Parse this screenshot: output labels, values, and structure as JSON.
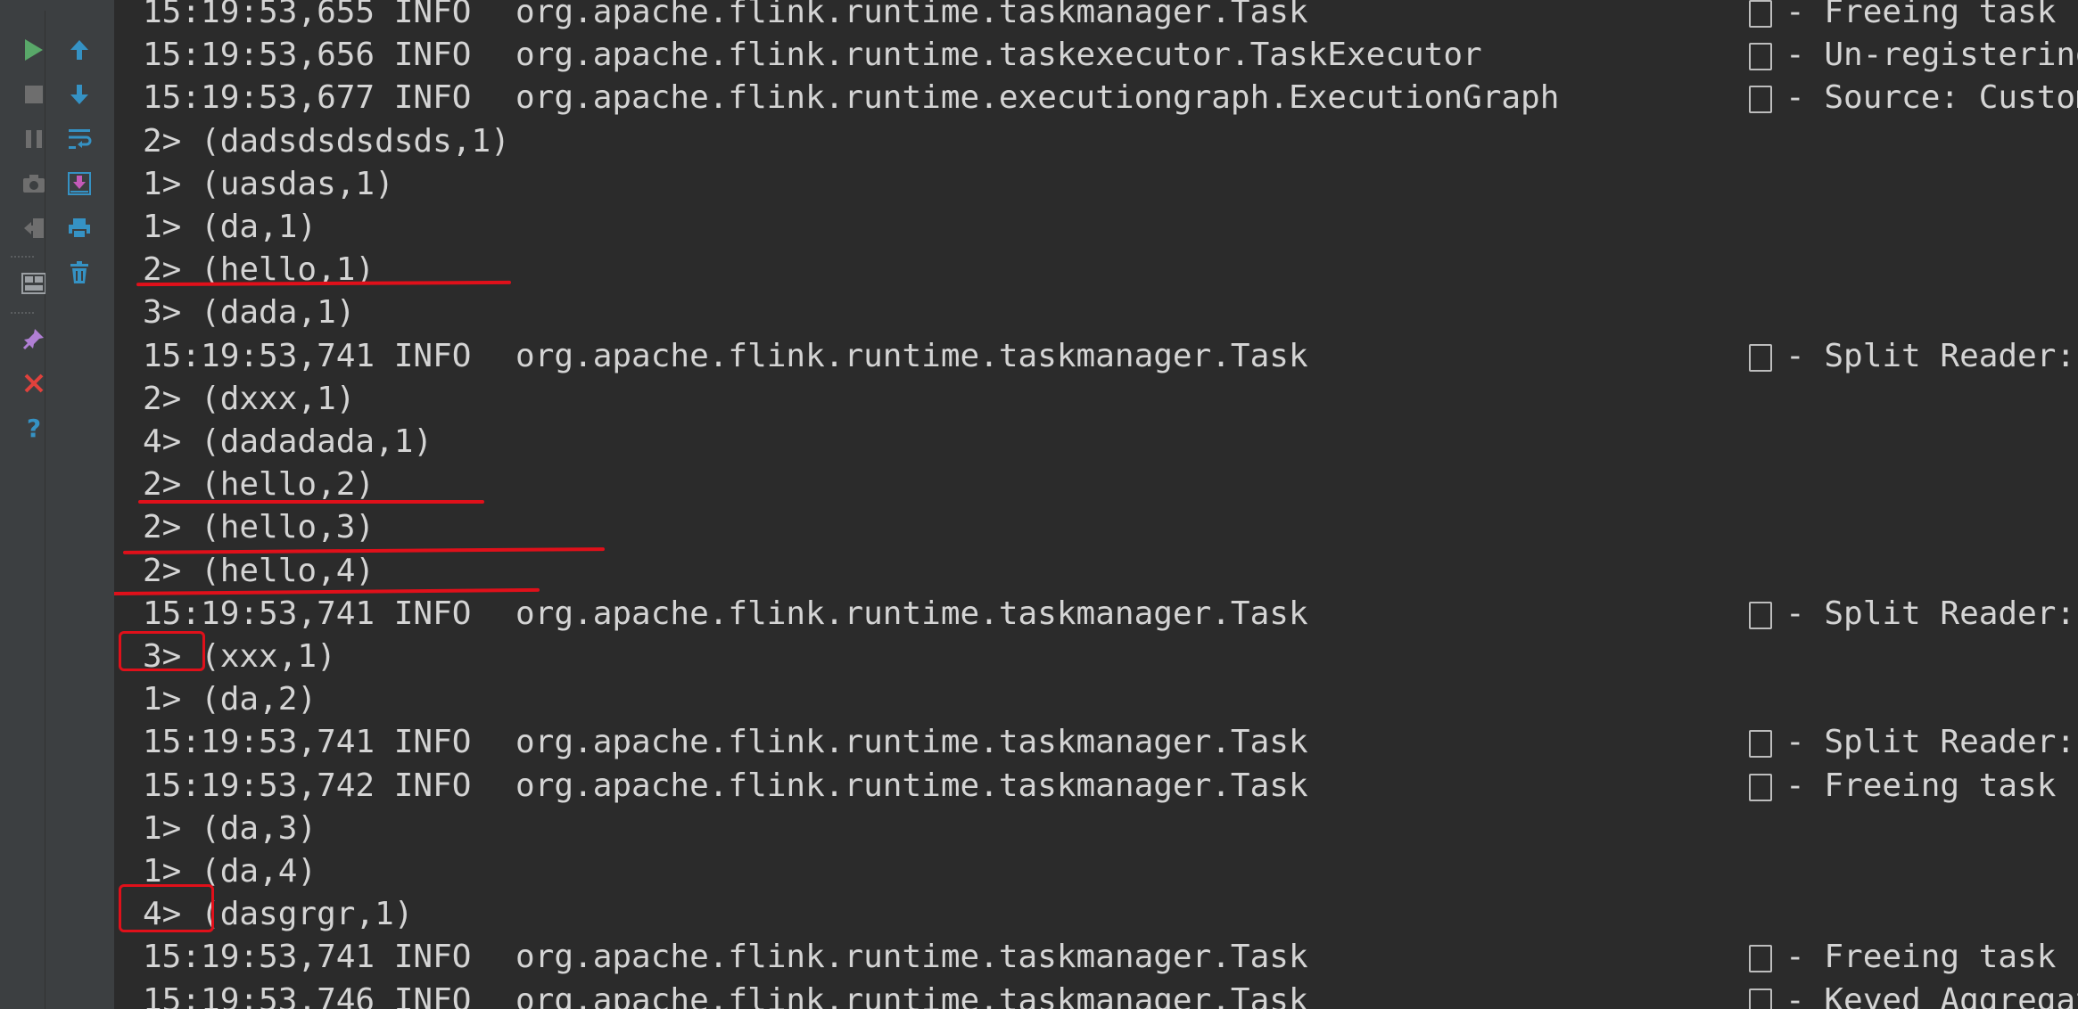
{
  "toolbar_left": [
    {
      "name": "run-icon",
      "color": "#59a869"
    },
    {
      "name": "stop-icon",
      "color": "#6e6e6e"
    },
    {
      "name": "pause-icon",
      "color": "#6e6e6e"
    },
    {
      "name": "camera-icon",
      "color": "#6e6e6e"
    },
    {
      "name": "exit-icon",
      "color": "#6e6e6e"
    },
    {
      "name": "layout-icon",
      "color": "#9ca0a4"
    },
    {
      "name": "pin-icon",
      "color": "#b07fd4"
    },
    {
      "name": "close-icon",
      "color": "#e0413c"
    },
    {
      "name": "help-icon",
      "color": "#3592c4"
    }
  ],
  "toolbar_right": [
    {
      "name": "arrow-up-icon",
      "color": "#3592c4"
    },
    {
      "name": "arrow-down-icon",
      "color": "#3592c4"
    },
    {
      "name": "soft-wrap-icon",
      "color": "#3592c4"
    },
    {
      "name": "scroll-to-end-icon",
      "color": "#3592c4"
    },
    {
      "name": "print-icon",
      "color": "#3592c4"
    },
    {
      "name": "trash-icon",
      "color": "#3592c4"
    }
  ],
  "console": {
    "lines": [
      {
        "ts": "15:19:53,655 INFO",
        "cls": "org.apache.flink.runtime.taskmanager.Task",
        "msg": "- Freeing task r"
      },
      {
        "ts": "15:19:53,656 INFO",
        "cls": "org.apache.flink.runtime.taskexecutor.TaskExecutor",
        "msg": "- Un-registering"
      },
      {
        "ts": "15:19:53,677 INFO",
        "cls": "org.apache.flink.runtime.executiongraph.ExecutionGraph",
        "msg": "- Source: Custom"
      },
      {
        "text": "2> (dadsdsdsdsds,1)"
      },
      {
        "text": "1> (uasdas,1)"
      },
      {
        "text": "1> (da,1)"
      },
      {
        "text": "2> (hello,1)"
      },
      {
        "text": "3> (dada,1)"
      },
      {
        "ts": "15:19:53,741 INFO",
        "cls": "org.apache.flink.runtime.taskmanager.Task",
        "msg": "- Split Reader:"
      },
      {
        "text": "2> (dxxx,1)"
      },
      {
        "text": "4> (dadadada,1)"
      },
      {
        "text": "2> (hello,2)"
      },
      {
        "text": "2> (hello,3)"
      },
      {
        "text": "2> (hello,4)"
      },
      {
        "ts": "15:19:53,741 INFO",
        "cls": "org.apache.flink.runtime.taskmanager.Task",
        "msg": "- Split Reader:"
      },
      {
        "text": "3> (xxx,1)"
      },
      {
        "text": "1> (da,2)"
      },
      {
        "ts": "15:19:53,741 INFO",
        "cls": "org.apache.flink.runtime.taskmanager.Task",
        "msg": "- Split Reader:"
      },
      {
        "ts": "15:19:53,742 INFO",
        "cls": "org.apache.flink.runtime.taskmanager.Task",
        "msg": "- Freeing task r"
      },
      {
        "text": "1> (da,3)"
      },
      {
        "text": "1> (da,4)"
      },
      {
        "text": "4> (dasgrgr,1)"
      },
      {
        "ts": "15:19:53,741 INFO",
        "cls": "org.apache.flink.runtime.taskmanager.Task",
        "msg": "- Freeing task r"
      },
      {
        "ts": "15:19:53,746 INFO",
        "cls": "org.apache.flink.runtime.taskmanager.Task",
        "msg": "- Keyed Aggregat"
      }
    ]
  },
  "colors": {
    "background": "#2b2b2b",
    "text": "#d4d4d4",
    "annotation": "#e0101a"
  }
}
